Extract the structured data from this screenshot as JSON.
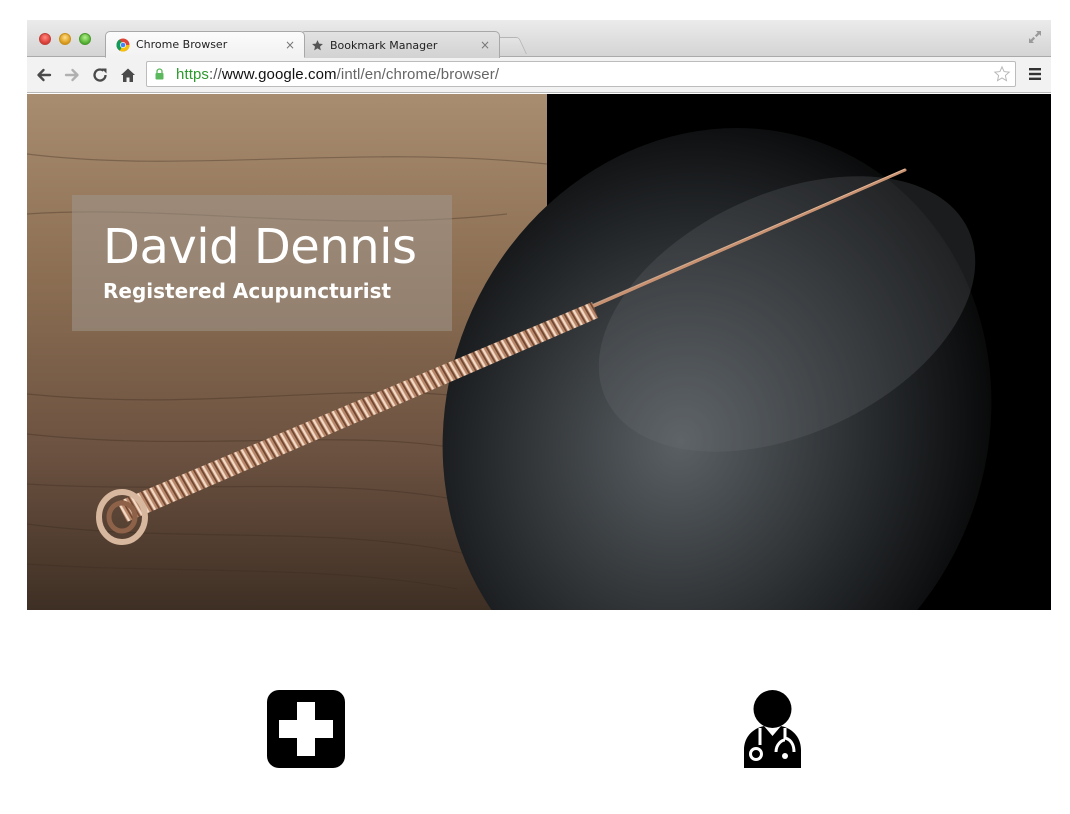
{
  "browser": {
    "tabs": [
      {
        "label": "Chrome Browser",
        "icon": "chrome-logo-icon",
        "active": true
      },
      {
        "label": "Bookmark Manager",
        "icon": "star-icon",
        "active": false
      }
    ],
    "address": {
      "scheme": "https",
      "separator": "://",
      "host": "www.google.com",
      "path": "/intl/en/chrome/browser/"
    },
    "tab_close_glyph": "×"
  },
  "hero": {
    "name": "David Dennis",
    "subtitle": "Registered Acupuncturist"
  },
  "features": [
    {
      "icon": "medical-cross-icon"
    },
    {
      "icon": "doctor-stethoscope-icon"
    }
  ]
}
